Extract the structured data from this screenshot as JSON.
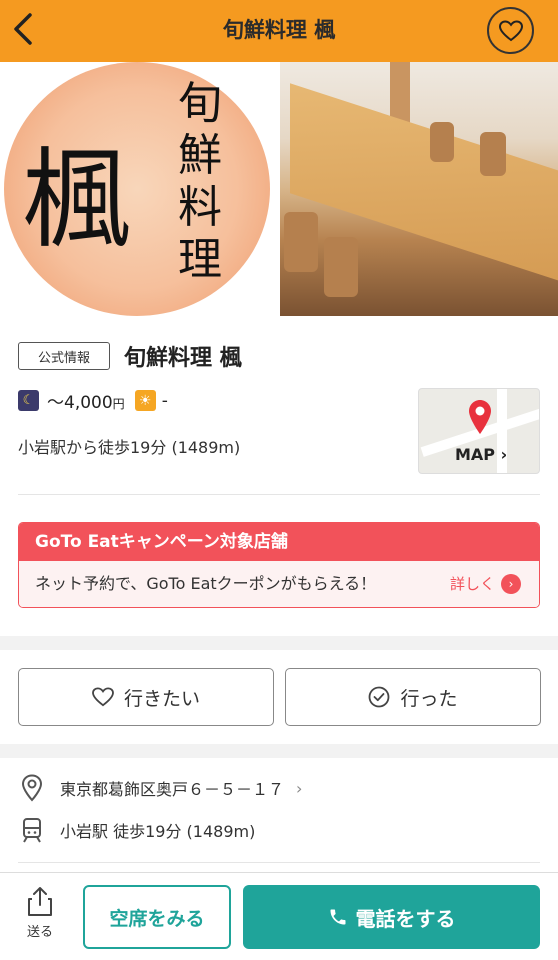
{
  "header": {
    "title": "旬鮮料理 楓"
  },
  "hero": {
    "logo_big": "楓",
    "logo_column": [
      "旬",
      "鮮",
      "料",
      "理"
    ]
  },
  "store": {
    "badge": "公式情報",
    "name": "旬鮮料理 楓",
    "dinner_price": "〜4,000",
    "yen": "円",
    "lunch_price": "-",
    "access": "小岩駅から徒歩19分 (1489m)",
    "map_label": "MAP ›"
  },
  "goto": {
    "title": "GoTo Eatキャンペーン対象店舗",
    "body": "ネット予約で、GoTo Eatクーポンがもらえる！",
    "more": "詳しく"
  },
  "actions": {
    "want": "行きたい",
    "went": "行った"
  },
  "address": {
    "text": "東京都葛飾区奥戸６－５－１７",
    "station": "小岩駅 徒歩19分 (1489m)"
  },
  "bottom": {
    "send": "送る",
    "seats": "空席をみる",
    "call": "電話をする"
  },
  "colors": {
    "header": "#f59a20",
    "accent": "#1fa49a",
    "goto": "#f2525a"
  }
}
